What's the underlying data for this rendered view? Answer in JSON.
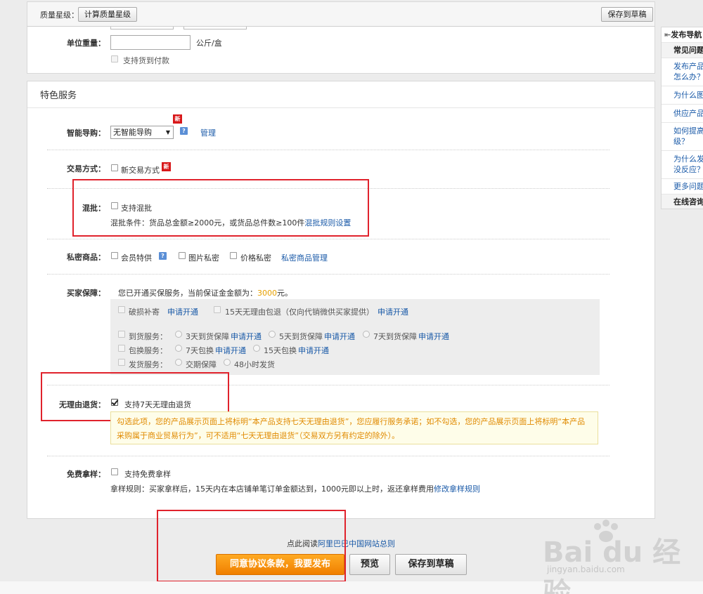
{
  "topbar": {
    "quality_label": "质量星级：",
    "calc_button": "计算质量星级",
    "save_draft_button": "保存到草稿"
  },
  "weight": {
    "label": "单位重量：",
    "value": "",
    "unit": "公斤/盒",
    "cod_label": "支持货到付款"
  },
  "section": {
    "title": "特色服务"
  },
  "smart_guide": {
    "label": "智能导购：",
    "select_value": "无智能导购",
    "new_badge": "新",
    "help": "?",
    "manage_link": "管理"
  },
  "trade_mode": {
    "label": "交易方式：",
    "option": "新交易方式",
    "new_badge": "新"
  },
  "mixed": {
    "label": "混批：",
    "option": "支持混批",
    "condition": "混批条件：货品总金额≥2000元，或货品总件数≥100件",
    "rule_link": "混批规则设置"
  },
  "private": {
    "label": "私密商品：",
    "member_price": "会员特供",
    "help": "?",
    "image_private": "图片私密",
    "price_private": "价格私密",
    "manage_link": "私密商品管理"
  },
  "buyer_protection": {
    "label": "买家保障：",
    "intro_prefix": "您已开通买保服务，当前保证金金额为：",
    "deposit": "3000",
    "intro_suffix": "元。",
    "damage": "破损补寄",
    "apply": "申请开通",
    "return15": "15天无理由包退（仅向代销微供买家提供）",
    "arrival_label": "到货服务：",
    "arrive3": "3天到货保障",
    "arrive5": "5天到货保障",
    "arrive7": "7天到货保障",
    "exchange_label": "包换服务：",
    "exchange7": "7天包换",
    "exchange15": "15天包换",
    "ship_label": "发货服务：",
    "ship_delivery": "交期保障",
    "ship_48": "48小时发货"
  },
  "no_reason": {
    "label": "无理由退货：",
    "option": "支持7天无理由退货",
    "checked": true,
    "notice": "勾选此项，您的产品展示页面上将标明“本产品支持七天无理由退货”，您应履行服务承诺；如不勾选，您的产品展示页面上将标明“本产品采购属于商业贸易行为”，可不适用“七天无理由退货”（交易双方另有约定的除外）。"
  },
  "free_sample": {
    "label": "免费拿样：",
    "option": "支持免费拿样",
    "rule": "拿样规则：买家拿样后，15天内在本店铺单笔订单金额达到，1000元即以上时，返还拿样费用",
    "modify_link": "修改拿样规则"
  },
  "bottom": {
    "agree_prefix": "点此阅读",
    "agree_link": "阿里巴巴中国网站总则",
    "publish_button": "同意协议条款，我要发布",
    "preview_button": "预览",
    "save_button": "保存到草稿"
  },
  "sidebar": {
    "title": "发布导航",
    "faq_header": "常见问题",
    "items": [
      "发布产品",
      "怎么办？",
      "为什么图",
      "供应产品",
      "如何提高",
      "级？",
      "为什么发",
      "没反应？",
      "更多问题"
    ],
    "online_consult": "在线咨询"
  },
  "watermark": {
    "brand": "Bai du 经验",
    "url": "jingyan.baidu.com"
  },
  "colors": {
    "accent_link": "#1a5aa8",
    "publish_orange": "#f28a00",
    "highlight_red": "#e0222c",
    "notice_text": "#e08a00"
  }
}
